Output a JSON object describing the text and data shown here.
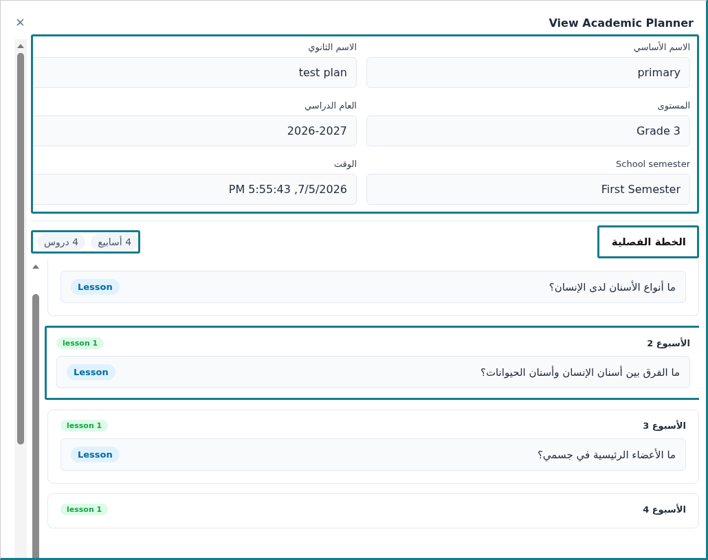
{
  "dialog": {
    "title": "View Academic Planner",
    "close": "×"
  },
  "form": {
    "highlighted": true,
    "fields": [
      {
        "label": "الاسم الأساسي",
        "value": "primary"
      },
      {
        "label": "الاسم الثانوي",
        "value": "test plan"
      },
      {
        "label": "المستوى",
        "value": "Grade 3"
      },
      {
        "label": "العام الدراسي",
        "value": "2026-2027"
      },
      {
        "label": "School semester",
        "value": "First Semester"
      },
      {
        "label": "الوقت",
        "value": "PM 5:55:43 ,7/5/2026"
      }
    ]
  },
  "plan": {
    "title": "الخطة الفصلية",
    "title_highlighted": true,
    "counts_highlighted": true,
    "counts": [
      "4 أسابيع",
      "4 دروس"
    ],
    "weeks": [
      {
        "highlighted": false,
        "lessons": [
          {
            "text": "ما أنواع الأسنان لدى الإنسان؟",
            "tag": "Lesson"
          }
        ]
      },
      {
        "highlighted": true,
        "title": "الأسبوع 2",
        "badge": "lesson 1",
        "lessons": [
          {
            "text": "ما الفرق بين أسنان الإنسان وأسنان الحيوانات؟",
            "tag": "Lesson"
          }
        ]
      },
      {
        "highlighted": false,
        "title": "الأسبوع 3",
        "badge": "lesson 1",
        "lessons": [
          {
            "text": "ما الأعضاء الرئيسية في جسمي؟",
            "tag": "Lesson"
          }
        ]
      },
      {
        "highlighted": false,
        "title": "الأسبوع 4",
        "badge": "lesson 1"
      }
    ]
  }
}
